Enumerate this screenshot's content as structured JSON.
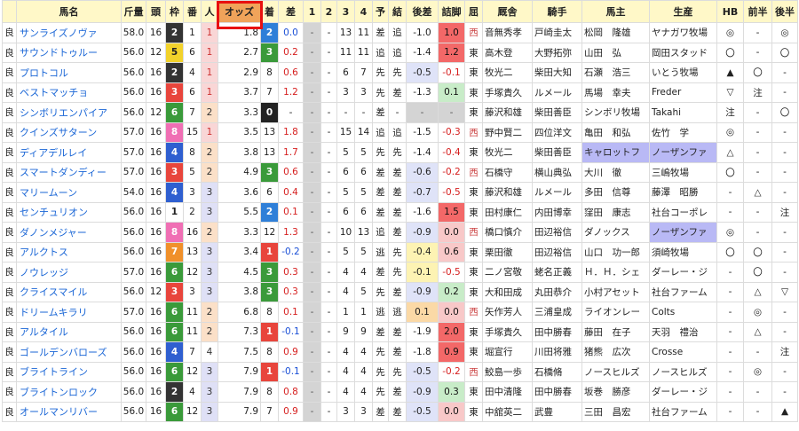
{
  "headers": [
    "馬名",
    "斤量",
    "頭",
    "枠",
    "番",
    "人",
    "オッズ",
    "着",
    "差",
    "1",
    "2",
    "3",
    "4",
    "予",
    "結",
    "後差",
    "詰脚",
    "屈",
    "厩舎",
    "騎手",
    "馬主",
    "生産",
    "HB",
    "前半",
    "後半"
  ],
  "rows": [
    {
      "track": "良",
      "name": "サンライズノヴァ",
      "kin": "58.0",
      "tou": "16",
      "waku": "2",
      "ban": "1",
      "pop": "1",
      "odds": "1.8",
      "fin": "2",
      "diff": "0.0",
      "c1": "-",
      "c2": "-",
      "c3": "13",
      "c4": "11",
      "yo": "差",
      "ketsu": "追",
      "go": "-1.0",
      "ag": "1.0",
      "agc": "ag-r",
      "gocls": "",
      "yaku": "西",
      "stable": "音無秀孝",
      "jockey": "戸崎圭太",
      "owner": "松岡　隆雄",
      "breeder": "ヤナガワ牧場",
      "hb": "◎",
      "zen": "-",
      "kou": "◎"
    },
    {
      "track": "良",
      "name": "サウンドトゥルー",
      "kin": "56.0",
      "tou": "12",
      "waku": "5",
      "ban": "6",
      "pop": "1",
      "odds": "2.7",
      "fin": "3",
      "diff": "0.2",
      "c1": "-",
      "c2": "-",
      "c3": "11",
      "c4": "11",
      "yo": "追",
      "ketsu": "追",
      "go": "-1.4",
      "ag": "1.2",
      "agc": "ag-r",
      "gocls": "",
      "yaku": "東",
      "stable": "高木登",
      "jockey": "大野拓弥",
      "owner": "山田　弘",
      "breeder": "岡田スタッド",
      "hb": "〇",
      "zen": "-",
      "kou": "〇"
    },
    {
      "track": "良",
      "name": "プロトコル",
      "kin": "56.0",
      "tou": "16",
      "waku": "2",
      "ban": "4",
      "pop": "1",
      "odds": "2.9",
      "fin": "8",
      "diff": "0.6",
      "c1": "-",
      "c2": "-",
      "c3": "6",
      "c4": "7",
      "yo": "先",
      "ketsu": "先",
      "go": "-0.5",
      "ag": "-0.1",
      "agc": "ag-n",
      "gocls": "neg-b",
      "yaku": "東",
      "stable": "牧光二",
      "jockey": "柴田大知",
      "owner": "石瀬　浩三",
      "breeder": "いとう牧場",
      "hb": "▲",
      "zen": "〇",
      "kou": "-"
    },
    {
      "track": "良",
      "name": "ベストマッチョ",
      "kin": "56.0",
      "tou": "16",
      "waku": "3",
      "ban": "6",
      "pop": "1",
      "odds": "3.7",
      "fin": "7",
      "diff": "1.2",
      "c1": "-",
      "c2": "-",
      "c3": "3",
      "c4": "3",
      "yo": "先",
      "ketsu": "差",
      "go": "-1.3",
      "ag": "0.1",
      "agc": "ag-g",
      "gocls": "",
      "yaku": "東",
      "stable": "手塚貴久",
      "jockey": "ルメール",
      "owner": "馬場　幸夫",
      "breeder": "Freder",
      "hb": "▽",
      "zen": "注",
      "kou": "-"
    },
    {
      "track": "良",
      "name": "シンボリエンパイア",
      "kin": "56.0",
      "tou": "12",
      "waku": "6",
      "ban": "7",
      "pop": "2",
      "odds": "3.3",
      "fin": "0",
      "diff": "-",
      "c1": "-",
      "c2": "-",
      "c3": "-",
      "c4": "-",
      "yo": "差",
      "ketsu": "-",
      "go": "-",
      "ag": "-",
      "agc": "dash",
      "gocls": "dash",
      "yaku": "東",
      "stable": "藤沢和雄",
      "jockey": "柴田善臣",
      "owner": "シンボリ牧場",
      "breeder": "Takahi",
      "hb": "注",
      "zen": "-",
      "kou": "〇"
    },
    {
      "track": "良",
      "name": "クインズサターン",
      "kin": "57.0",
      "tou": "16",
      "waku": "8",
      "ban": "15",
      "pop": "1",
      "odds": "3.5",
      "fin": "13",
      "diff": "1.8",
      "c1": "-",
      "c2": "-",
      "c3": "15",
      "c4": "14",
      "yo": "追",
      "ketsu": "追",
      "go": "-1.5",
      "ag": "-0.3",
      "agc": "ag-n",
      "gocls": "",
      "yaku": "西",
      "stable": "野中賢二",
      "jockey": "四位洋文",
      "owner": "亀田　和弘",
      "breeder": "佐竹　学",
      "hb": "◎",
      "zen": "-",
      "kou": "-"
    },
    {
      "track": "良",
      "name": "ディアデルレイ",
      "kin": "57.0",
      "tou": "16",
      "waku": "4",
      "ban": "8",
      "pop": "2",
      "odds": "3.8",
      "fin": "13",
      "diff": "1.7",
      "c1": "-",
      "c2": "-",
      "c3": "5",
      "c4": "5",
      "yo": "先",
      "ketsu": "先",
      "go": "-1.4",
      "ag": "-0.4",
      "agc": "ag-n",
      "gocls": "",
      "yaku": "東",
      "stable": "牧光二",
      "jockey": "柴田善臣",
      "owner": "キャロットフ",
      "breeder": "ノーザンファ",
      "hl": true,
      "hb": "△",
      "zen": "-",
      "kou": "-"
    },
    {
      "track": "良",
      "name": "スマートダンディー",
      "kin": "57.0",
      "tou": "16",
      "waku": "3",
      "ban": "5",
      "pop": "2",
      "odds": "4.9",
      "fin": "3",
      "diff": "0.6",
      "c1": "-",
      "c2": "-",
      "c3": "6",
      "c4": "6",
      "yo": "差",
      "ketsu": "差",
      "go": "-0.6",
      "ag": "-0.2",
      "agc": "ag-n",
      "gocls": "neg-b",
      "yaku": "西",
      "stable": "石橋守",
      "jockey": "横山典弘",
      "owner": "大川　徹",
      "breeder": "三嶋牧場",
      "hb": "〇",
      "zen": "-",
      "kou": "-"
    },
    {
      "track": "良",
      "name": "マリームーン",
      "kin": "54.0",
      "tou": "16",
      "waku": "4",
      "ban": "3",
      "pop": "3",
      "odds": "3.6",
      "fin": "6",
      "diff": "0.4",
      "c1": "-",
      "c2": "-",
      "c3": "5",
      "c4": "5",
      "yo": "差",
      "ketsu": "差",
      "go": "-0.7",
      "ag": "-0.5",
      "agc": "ag-n",
      "gocls": "neg-b",
      "yaku": "東",
      "stable": "藤沢和雄",
      "jockey": "ルメール",
      "owner": "多田　信尊",
      "breeder": "藤澤　昭勝",
      "hb": "-",
      "zen": "△",
      "kou": "-"
    },
    {
      "track": "良",
      "name": "センチュリオン",
      "kin": "56.0",
      "tou": "16",
      "waku": "1",
      "ban": "2",
      "pop": "3",
      "odds": "5.5",
      "fin": "2",
      "diff": "0.1",
      "c1": "-",
      "c2": "-",
      "c3": "6",
      "c4": "6",
      "yo": "差",
      "ketsu": "差",
      "go": "-1.6",
      "ag": "1.5",
      "agc": "ag-r",
      "gocls": "",
      "yaku": "東",
      "stable": "田村康仁",
      "jockey": "内田博幸",
      "owner": "窪田　康志",
      "breeder": "社台コーポレ",
      "hb": "-",
      "zen": "-",
      "kou": "注"
    },
    {
      "track": "良",
      "name": "ダノンメジャー",
      "kin": "56.0",
      "tou": "16",
      "waku": "8",
      "ban": "16",
      "pop": "2",
      "odds": "3.3",
      "fin": "12",
      "diff": "1.3",
      "c1": "-",
      "c2": "-",
      "c3": "10",
      "c4": "13",
      "yo": "追",
      "ketsu": "差",
      "go": "-0.9",
      "ag": "0.0",
      "agc": "ag-p",
      "gocls": "neg-b",
      "yaku": "西",
      "stable": "橋口慎介",
      "jockey": "田辺裕信",
      "owner": "ダノックス",
      "breeder": "ノーザンファ",
      "hlb": true,
      "hb": "◎",
      "zen": "-",
      "kou": "-"
    },
    {
      "track": "良",
      "name": "アルクトス",
      "kin": "56.0",
      "tou": "16",
      "waku": "7",
      "ban": "13",
      "pop": "3",
      "odds": "3.4",
      "fin": "1",
      "diff": "-0.2",
      "c1": "-",
      "c2": "-",
      "c3": "5",
      "c4": "5",
      "yo": "逃",
      "ketsu": "先",
      "go": "-0.4",
      "ag": "0.6",
      "agc": "ag-p",
      "gocls": "pos-b",
      "yaku": "東",
      "stable": "栗田徹",
      "jockey": "田辺裕信",
      "owner": "山口　功一郎",
      "breeder": "須崎牧場",
      "hb": "〇",
      "zen": "〇",
      "kou": "-"
    },
    {
      "track": "良",
      "name": "ノウレッジ",
      "kin": "57.0",
      "tou": "16",
      "waku": "6",
      "ban": "12",
      "pop": "3",
      "odds": "4.5",
      "fin": "3",
      "diff": "0.3",
      "c1": "-",
      "c2": "-",
      "c3": "4",
      "c4": "4",
      "yo": "差",
      "ketsu": "先",
      "go": "-0.1",
      "ag": "-0.5",
      "agc": "ag-n",
      "gocls": "pos-b",
      "yaku": "東",
      "stable": "二ノ宮敬",
      "jockey": "蛯名正義",
      "owner": "Ｈ．Ｈ．シェ",
      "breeder": "ダーレー・ジ",
      "hb": "-",
      "zen": "〇",
      "kou": "-"
    },
    {
      "track": "良",
      "name": "クライスマイル",
      "kin": "56.0",
      "tou": "12",
      "waku": "3",
      "ban": "3",
      "pop": "3",
      "odds": "3.8",
      "fin": "3",
      "diff": "0.3",
      "c1": "-",
      "c2": "-",
      "c3": "4",
      "c4": "5",
      "yo": "先",
      "ketsu": "差",
      "go": "-0.9",
      "ag": "0.2",
      "agc": "ag-g",
      "gocls": "neg-b",
      "yaku": "東",
      "stable": "大和田成",
      "jockey": "丸田恭介",
      "owner": "小村アセット",
      "breeder": "社台ファーム",
      "hb": "-",
      "zen": "△",
      "kou": "▽"
    },
    {
      "track": "良",
      "name": "ドリームキラリ",
      "kin": "57.0",
      "tou": "16",
      "waku": "6",
      "ban": "11",
      "pop": "2",
      "odds": "6.8",
      "fin": "8",
      "diff": "0.1",
      "c1": "-",
      "c2": "-",
      "c3": "1",
      "c4": "1",
      "yo": "逃",
      "ketsu": "逃",
      "go": "0.1",
      "ag": "0.0",
      "agc": "ag-p",
      "gocls": "pos-o",
      "yaku": "西",
      "stable": "矢作芳人",
      "jockey": "三浦皇成",
      "owner": "ライオンレー",
      "breeder": "Colts",
      "hb": "-",
      "zen": "◎",
      "kou": "-"
    },
    {
      "track": "良",
      "name": "アルタイル",
      "kin": "56.0",
      "tou": "16",
      "waku": "6",
      "ban": "11",
      "pop": "2",
      "odds": "7.3",
      "fin": "1",
      "diff": "-0.1",
      "c1": "-",
      "c2": "-",
      "c3": "9",
      "c4": "9",
      "yo": "差",
      "ketsu": "差",
      "go": "-1.9",
      "ag": "2.0",
      "agc": "ag-r",
      "gocls": "",
      "yaku": "東",
      "stable": "手塚貴久",
      "jockey": "田中勝春",
      "owner": "藤田　在子",
      "breeder": "天羽　禮治",
      "hb": "-",
      "zen": "△",
      "kou": "-"
    },
    {
      "track": "良",
      "name": "ゴールデンバローズ",
      "kin": "56.0",
      "tou": "16",
      "waku": "4",
      "ban": "7",
      "pop": "4",
      "odds": "7.5",
      "fin": "8",
      "diff": "0.9",
      "c1": "-",
      "c2": "-",
      "c3": "4",
      "c4": "4",
      "yo": "先",
      "ketsu": "差",
      "go": "-1.8",
      "ag": "0.9",
      "agc": "ag-r",
      "gocls": "",
      "yaku": "東",
      "stable": "堀宣行",
      "jockey": "川田将雅",
      "owner": "猪熊　広次",
      "breeder": "Crosse",
      "hb": "-",
      "zen": "-",
      "kou": "注"
    },
    {
      "track": "良",
      "name": "ブライトライン",
      "kin": "56.0",
      "tou": "16",
      "waku": "6",
      "ban": "12",
      "pop": "3",
      "odds": "7.9",
      "fin": "1",
      "diff": "-0.1",
      "c1": "-",
      "c2": "-",
      "c3": "4",
      "c4": "4",
      "yo": "先",
      "ketsu": "先",
      "go": "-0.5",
      "ag": "-0.2",
      "agc": "ag-n",
      "gocls": "neg-b",
      "yaku": "西",
      "stable": "鮫島一歩",
      "jockey": "石橋脩",
      "owner": "ノースヒルズ",
      "breeder": "ノースヒルズ",
      "hb": "-",
      "zen": "◎",
      "kou": "-"
    },
    {
      "track": "良",
      "name": "ブライトンロック",
      "kin": "56.0",
      "tou": "16",
      "waku": "2",
      "ban": "4",
      "pop": "3",
      "odds": "7.9",
      "fin": "8",
      "diff": "0.8",
      "c1": "-",
      "c2": "-",
      "c3": "4",
      "c4": "4",
      "yo": "先",
      "ketsu": "差",
      "go": "-0.9",
      "ag": "0.3",
      "agc": "ag-g",
      "gocls": "neg-b",
      "yaku": "東",
      "stable": "田中清隆",
      "jockey": "田中勝春",
      "owner": "坂巻　勝彦",
      "breeder": "ダーレー・ジ",
      "hb": "-",
      "zen": "-",
      "kou": "-"
    },
    {
      "track": "良",
      "name": "オールマンリバー",
      "kin": "56.0",
      "tou": "16",
      "waku": "6",
      "ban": "12",
      "pop": "3",
      "odds": "7.9",
      "fin": "7",
      "diff": "0.9",
      "c1": "-",
      "c2": "-",
      "c3": "3",
      "c4": "3",
      "yo": "差",
      "ketsu": "差",
      "go": "-0.5",
      "ag": "0.0",
      "agc": "ag-p",
      "gocls": "neg-b",
      "yaku": "東",
      "stable": "中舘英二",
      "jockey": "武豊",
      "owner": "三田　昌宏",
      "breeder": "社台ファーム",
      "hb": "-",
      "zen": "-",
      "kou": "▲"
    }
  ]
}
